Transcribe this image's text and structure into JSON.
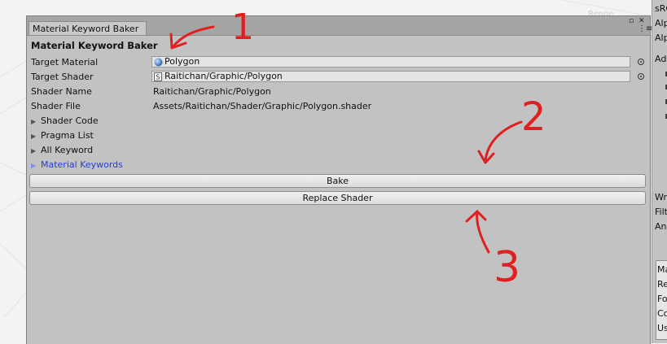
{
  "window": {
    "tab_title": "Material Keyword Baker",
    "heading": "Material Keyword Baker"
  },
  "fields": {
    "target_material": {
      "label": "Target Material",
      "value": "Polygon"
    },
    "target_shader": {
      "label": "Target Shader",
      "value": "Raitichan/Graphic/Polygon"
    },
    "shader_name": {
      "label": "Shader Name",
      "value": "Raitichan/Graphic/Polygon"
    },
    "shader_file": {
      "label": "Shader File",
      "value": "Assets/Raitichan/Shader/Graphic/Polygon.shader"
    }
  },
  "foldouts": {
    "shader_code": "Shader Code",
    "pragma_list": "Pragma List",
    "all_keyword": "All Keyword",
    "material_keywords": "Material Keywords"
  },
  "buttons": {
    "bake": "Bake",
    "replace_shader": "Replace Shader"
  },
  "right_panel": {
    "items": [
      "sRG",
      "Alp",
      "Alp",
      "Adv",
      "Wr",
      "Filt",
      "Ani",
      "Ma",
      "Re",
      "Fo",
      "Co",
      "Us"
    ]
  },
  "background": {
    "ghost_text": "Renge"
  },
  "annotations": {
    "one": "1",
    "two": "2",
    "three": "3"
  },
  "colors": {
    "annotation_red": "#e02020",
    "foldout_active": "#2340d6"
  }
}
